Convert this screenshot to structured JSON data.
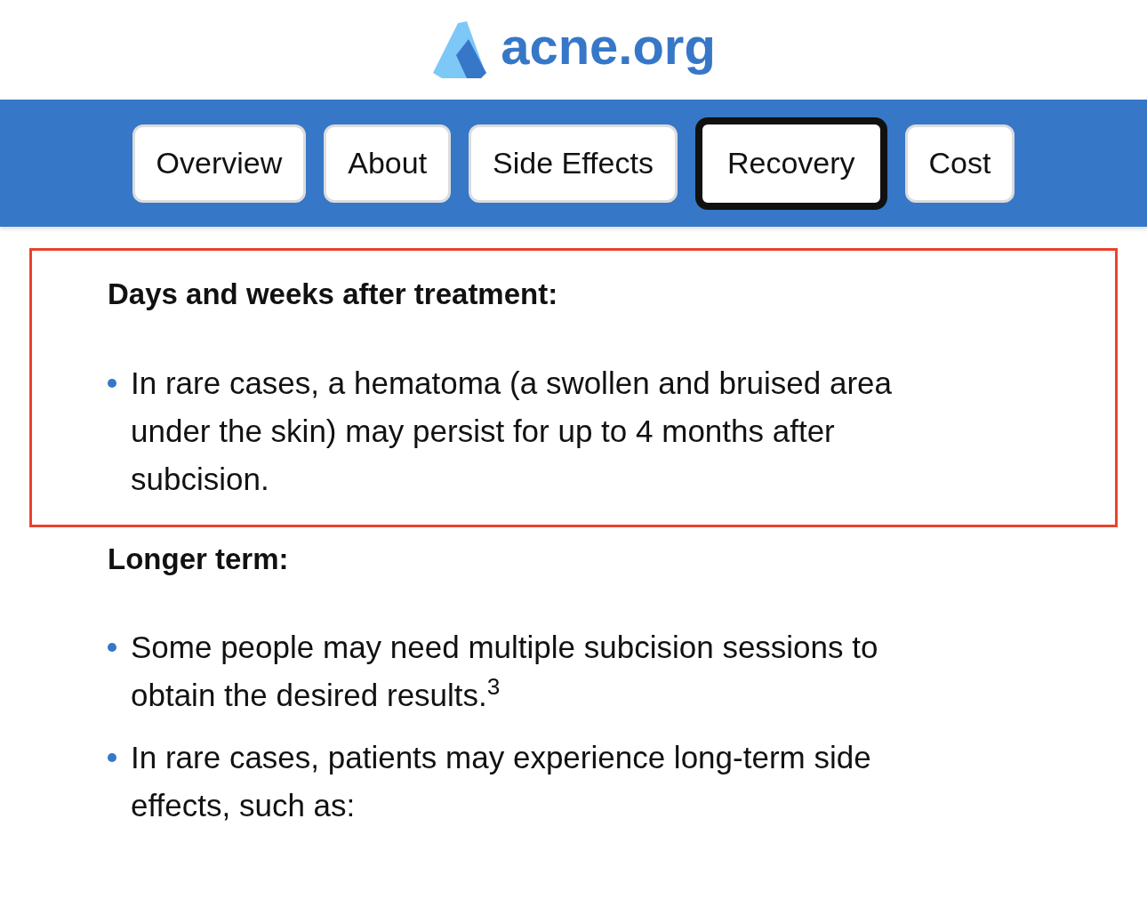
{
  "logo": {
    "text": "acne.org"
  },
  "tabs": [
    {
      "label": "Overview",
      "selected": false
    },
    {
      "label": "About",
      "selected": false
    },
    {
      "label": "Side Effects",
      "selected": false
    },
    {
      "label": "Recovery",
      "selected": true
    },
    {
      "label": "Cost",
      "selected": false
    }
  ],
  "sections": [
    {
      "heading": "Days and weeks after treatment:",
      "highlighted": true,
      "bullets": [
        "In rare cases, a hematoma (a swollen and bruised area under the skin) may persist for up to 4 months after subcision."
      ]
    },
    {
      "heading": "Longer term:",
      "highlighted": false,
      "bullets": [
        "Some people may need multiple subcision sessions to obtain the desired results.$^{3}$",
        "In rare cases, patients may experience long-term side effects, such as:"
      ]
    }
  ]
}
